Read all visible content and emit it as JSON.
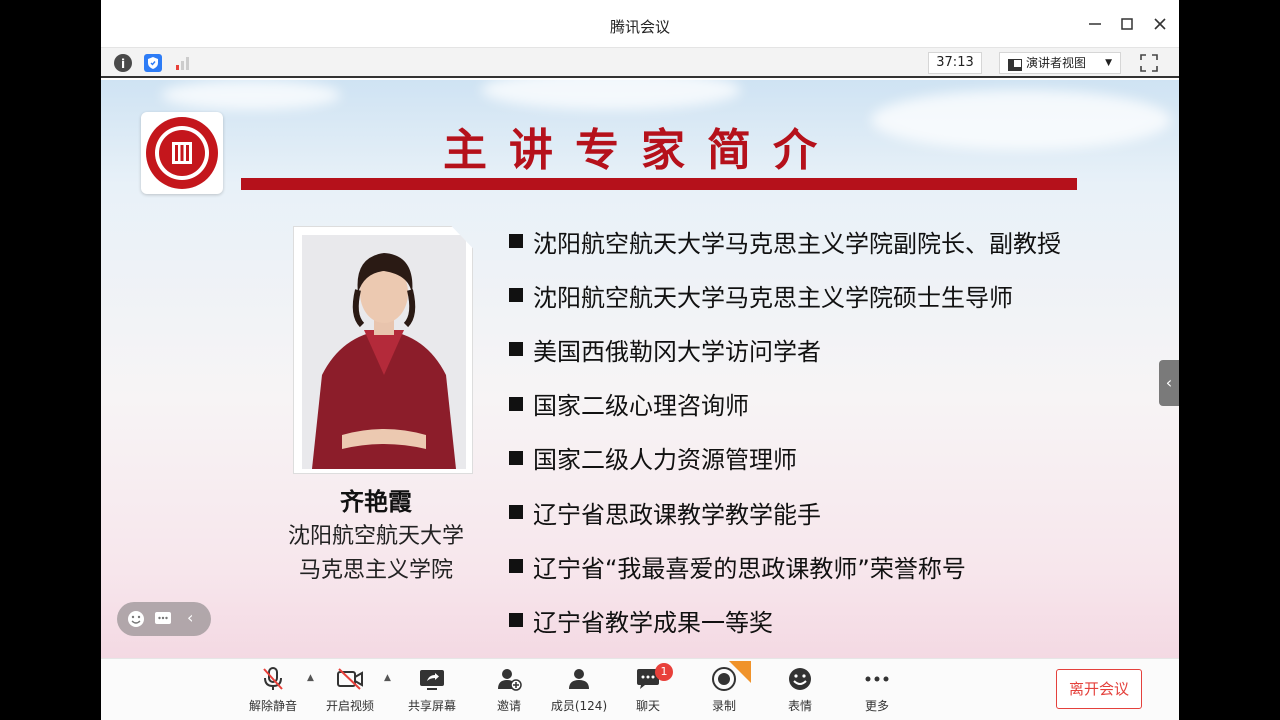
{
  "window": {
    "title": "腾讯会议"
  },
  "toolbar": {
    "timer": "37:13",
    "view_mode": "演讲者视图"
  },
  "slide": {
    "title": "主讲专家简介",
    "speaker": {
      "name": "齐艳霞",
      "affiliation_line1": "沈阳航空航天大学",
      "affiliation_line2": "马克思主义学院"
    },
    "bullets": [
      "沈阳航空航天大学马克思主义学院副院长、副教授",
      "沈阳航空航天大学马克思主义学院硕士生导师",
      "美国西俄勒冈大学访问学者",
      "国家二级心理咨询师",
      "国家二级人力资源管理师",
      "辽宁省思政课教学教学能手",
      "辽宁省“我最喜爱的思政课教师”荣誉称号",
      "辽宁省教学成果一等奖"
    ]
  },
  "controls": {
    "unmute": "解除静音",
    "video": "开启视频",
    "share": "共享屏幕",
    "invite": "邀请",
    "members": "成员(124)",
    "chat": "聊天",
    "chat_badge": "1",
    "record": "录制",
    "emoji": "表情",
    "more": "更多",
    "leave": "离开会议"
  },
  "colors": {
    "accent_red": "#b5111b",
    "leave_red": "#e4413c",
    "badge_red": "#e8403a"
  }
}
